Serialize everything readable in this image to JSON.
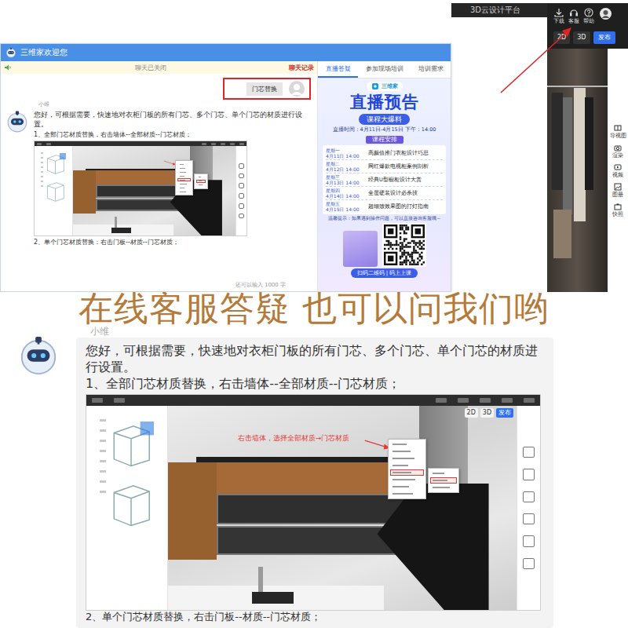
{
  "app": {
    "title": "3D云设计平台",
    "toolbar": [
      {
        "label": "下载"
      },
      {
        "label": "客服"
      },
      {
        "label": "帮助"
      }
    ],
    "view_modes": [
      {
        "label": "2D",
        "selected": false
      },
      {
        "label": "3D",
        "selected": false
      }
    ],
    "publish_button": "发布",
    "side_tools": [
      "导视图",
      "渲染",
      "视频",
      "图册",
      "快照"
    ]
  },
  "chat": {
    "title": "三维家欢迎您",
    "notice": "聊天已关闭",
    "history_link": "聊天记录",
    "user_message": "门芯替换",
    "agent_name": "小维",
    "agent_message": "您好，可根据需要，快速地对衣柜门板的所有门芯、多个门芯、单个门芯的材质进行设置。",
    "step1": "1、全部门芯材质替换，右击墙体--全部材质--门芯材质；",
    "step2": "2、单个门芯材质替换：右击门板--材质--门芯材质；",
    "counter": "还可以输入 1000 字",
    "tabs": [
      {
        "label": "直播答疑",
        "selected": true
      },
      {
        "label": "参加现场培训",
        "selected": false
      },
      {
        "label": "培训需求",
        "selected": false
      }
    ],
    "promo": {
      "brand": "三维家",
      "title": "直播预告",
      "subtitle": "课程大爆料",
      "time": "直播时间：4月11日-4月15日  下午：14:00",
      "schedule_title": "课程安排",
      "schedule": [
        {
          "day": "星期一",
          "date": "4月11日 14:00",
          "topic": "高颜值推门衣柜设计巧思"
        },
        {
          "day": "星期二",
          "date": "4月12日 14:00",
          "topic": "网红爆款电视柜案例剖析"
        },
        {
          "day": "星期三",
          "date": "4月13日 14:00",
          "topic": "经典U型橱柜设计大赏"
        },
        {
          "day": "星期四",
          "date": "4月14日 14:00",
          "topic": "全屋硬装设计必杀技"
        },
        {
          "day": "星期五",
          "date": "4月15日 14:00",
          "topic": "超细致效果图的打灯指南"
        }
      ],
      "tip": "温馨提示：如果遇到操作问题，可以直接咨询客服哦～",
      "qr_caption": "扫码二维码 | 码上上课"
    }
  },
  "banner": "在线客服答疑 也可以问我们哟",
  "zoom": {
    "agent_name": "小维",
    "message": "您好，可根据需要，快速地对衣柜门板的所有门芯、多个门芯、单个门芯的材质进行设置。",
    "step1": "1、全部门芯材质替换，右击墙体--全部材质--门芯材质；",
    "step2": "2、单个门芯材质替换，右击门板--材质--门芯材质；",
    "screenshot": {
      "annotation": "右击墙体，选择全部材质→门芯材质",
      "view_buttons": [
        "2D",
        "3D",
        "发布"
      ],
      "menu": [
        {
          "highlighted": false
        },
        {
          "highlighted": false
        },
        {
          "highlighted": false
        },
        {
          "highlighted": false
        },
        {
          "highlighted": true
        },
        {
          "highlighted": false
        },
        {
          "highlighted": false
        },
        {
          "highlighted": false
        }
      ],
      "submenu": [
        {
          "highlighted": false
        },
        {
          "highlighted": true
        },
        {
          "highlighted": false
        }
      ]
    }
  }
}
